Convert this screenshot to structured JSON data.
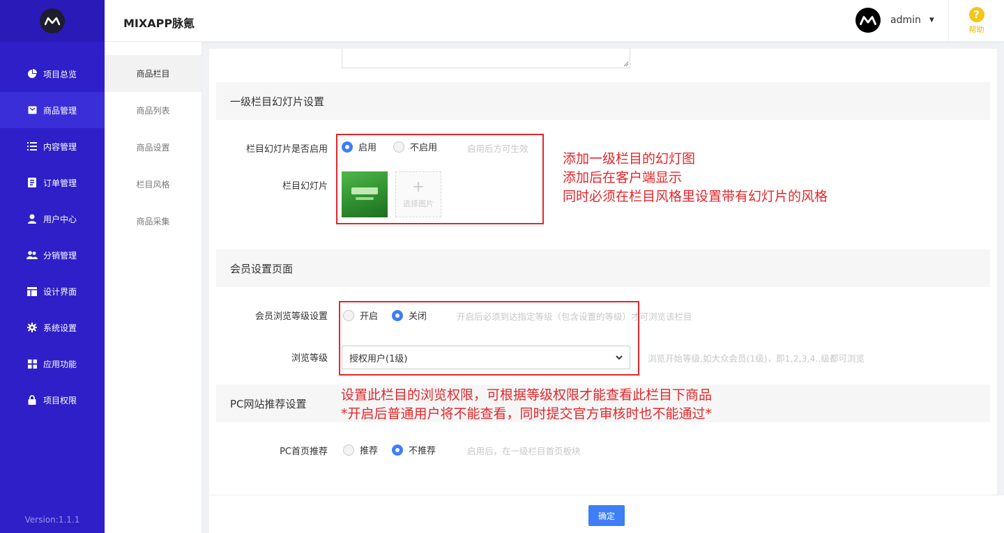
{
  "app": {
    "title": "MIXAPP脉氪"
  },
  "sidebar": {
    "items": [
      {
        "label": "项目总览",
        "icon": "pie-chart-icon"
      },
      {
        "label": "商品管理",
        "icon": "box-icon",
        "active": true
      },
      {
        "label": "内容管理",
        "icon": "list-icon"
      },
      {
        "label": "订单管理",
        "icon": "document-icon"
      },
      {
        "label": "用户中心",
        "icon": "user-icon"
      },
      {
        "label": "分销管理",
        "icon": "users-icon"
      },
      {
        "label": "设计界面",
        "icon": "layout-icon"
      },
      {
        "label": "系统设置",
        "icon": "gear-icon"
      },
      {
        "label": "应用功能",
        "icon": "grid-icon"
      },
      {
        "label": "项目权限",
        "icon": "lock-icon"
      }
    ],
    "version": "Version:1.1.1"
  },
  "subnav": {
    "items": [
      {
        "label": "商品栏目",
        "active": true
      },
      {
        "label": "商品列表"
      },
      {
        "label": "商品设置"
      },
      {
        "label": "栏目风格"
      },
      {
        "label": "商品采集"
      }
    ]
  },
  "topbar": {
    "username": "admin",
    "help_label": "帮助"
  },
  "section_slides": {
    "title": "一级栏目幻灯片设置",
    "enable_label": "栏目幻灯片是否启用",
    "enable_on": "启用",
    "enable_off": "不启用",
    "enable_hint": "启用后方可生效",
    "slides_label": "栏目幻灯片",
    "add_image_label": "选择图片",
    "annotation": [
      "添加一级栏目的幻灯图",
      "添加后在客户端显示",
      "同时必须在栏目风格里设置带有幻灯片的风格"
    ]
  },
  "section_member": {
    "title": "会员设置页面",
    "browse_label": "会员浏览等级设置",
    "browse_on": "开启",
    "browse_off": "关闭",
    "browse_hint": "开启后必须到达指定等级（包含设置的等级）才可浏览该栏目",
    "level_label": "浏览等级",
    "level_selected": "授权用户(1级)",
    "level_hint": "浏览开始等级,如大众会员(1级)，即1,2,3,4..级都可浏览",
    "annotation": [
      "设置此栏目的浏览权限，可根据等级权限才能查看此栏目下商品",
      "*开启后普通用户将不能查看，同时提交官方审核时也不能通过*"
    ]
  },
  "section_pc": {
    "title": "PC网站推荐设置",
    "recommend_label": "PC首页推荐",
    "recommend_on": "推荐",
    "recommend_off": "不推荐",
    "recommend_hint": "启用后，在一级栏目首页板块"
  },
  "footer": {
    "confirm_label": "确定"
  },
  "colors": {
    "sidebar": "#2e1fc8",
    "accent": "#3f7ef7",
    "annotation": "#e5262a",
    "help": "#f5c518"
  }
}
